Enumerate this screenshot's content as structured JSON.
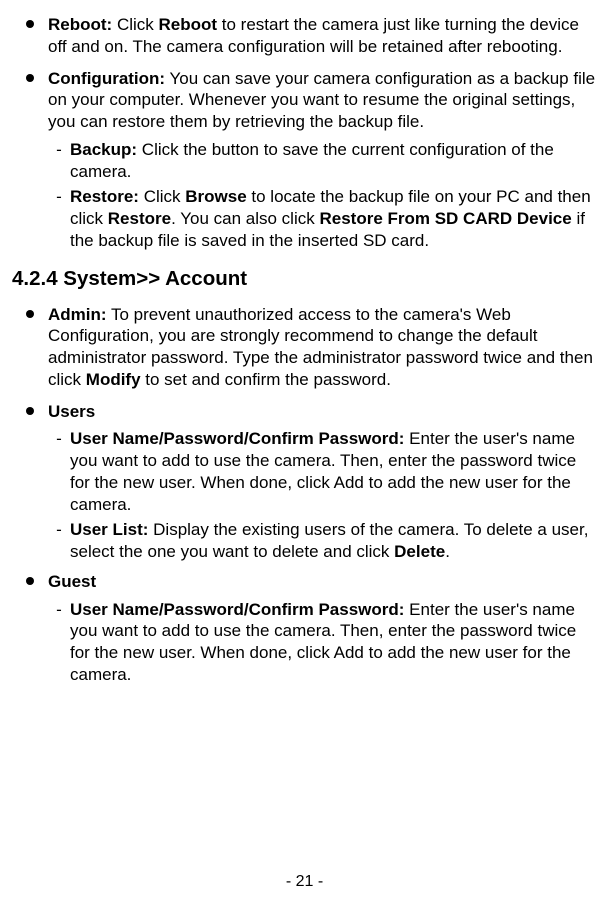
{
  "items": [
    {
      "title": "Reboot:",
      "text": " Click ",
      "bold_inline": "Reboot",
      "text2": " to restart the camera just like turning the device off and on. The camera configuration will be retained after rebooting."
    },
    {
      "title": "Configuration:",
      "text": " You can save your camera configuration as a backup file on your computer. Whenever you want to resume the original settings, you can restore them by retrieving the backup file.",
      "subs": [
        {
          "title": "Backup:",
          "text": " Click the button to save the current configuration of the camera."
        },
        {
          "title": "Restore:",
          "pre": " Click ",
          "b1": "Browse",
          "mid": " to locate the backup file on your PC and then click ",
          "b2": "Restore",
          "mid2": ". You can also click ",
          "b3": "Restore From SD CARD Device",
          "post": " if the backup file is saved in the inserted SD card."
        }
      ]
    }
  ],
  "section": "4.2.4 System>> Account",
  "items2": [
    {
      "title": "Admin:",
      "text": " To prevent unauthorized access to the camera's Web Configuration, you are strongly recommend to change the default administrator password. Type the administrator password twice and then click ",
      "bold_inline": "Modify",
      "text2": " to set and confirm the password."
    },
    {
      "title": "Users",
      "subs": [
        {
          "title": "User Name/Password/Confirm Password:",
          "text": " Enter the user's name you want to add to use the camera. Then, enter the password twice for the new user. When done, click Add to add the new user for the camera."
        },
        {
          "title": "User List:",
          "pre": " Display the existing users of the camera. To delete a user, select the one you want to delete and click ",
          "b1": "Delete",
          "post": "."
        }
      ]
    },
    {
      "title": "Guest",
      "subs": [
        {
          "title": "User Name/Password/Confirm Password:",
          "text": " Enter the user's name you want to add to use the camera. Then, enter the password twice for the new user. When done, click Add to add the new user for the camera."
        }
      ]
    }
  ],
  "pagenum": "- 21 -"
}
